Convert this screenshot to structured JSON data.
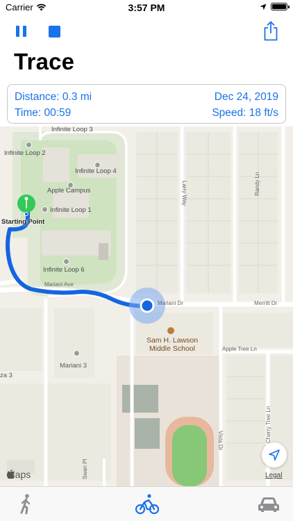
{
  "status_bar": {
    "carrier": "Carrier",
    "time": "3:57 PM"
  },
  "toolbar": {
    "pause_icon": "pause-icon",
    "stop_icon": "stop-icon",
    "share_icon": "share-icon",
    "accent_color": "#1a73e8"
  },
  "header": {
    "title": "Trace"
  },
  "stats": {
    "distance": "Distance: 0.3 mi",
    "date": "Dec 24, 2019",
    "time": "Time: 00:59",
    "speed": "Speed: 18 ft/s"
  },
  "map": {
    "places": {
      "infinite_loop_3": "Infinite Loop 3",
      "infinite_loop_2": "Infinite Loop 2",
      "infinite_loop_4": "Infinite Loop 4",
      "apple_campus": "Apple Campus",
      "infinite_loop_1": "Infinite Loop 1",
      "infinite_loop_6": "Infinite Loop 6",
      "mariani_3": "Mariani 3",
      "za_3": "za 3",
      "school_line1": "Sam H. Lawson",
      "school_line2": "Middle School"
    },
    "roads": {
      "larry_way": "Larry Way",
      "randy_ln": "Randy Ln",
      "mariani_ave": "Mariani Ave",
      "mariani_dr": "Mariani Dr",
      "merritt_dr": "Merritt Dr",
      "apple_tree_ln": "Apple Tree Ln",
      "cherry_tree_ln": "Cherry Tree Ln",
      "vista_dr": "Vista Dr",
      "swan_pl": "Swan Pl"
    },
    "start_label": "Starting Point",
    "maps_logo": "Maps",
    "legal": "Legal",
    "route_color": "#1565e0",
    "pin_color": "#34c759"
  },
  "tabs": {
    "walk_icon": "walk-icon",
    "bike_icon": "bike-icon",
    "car_icon": "car-icon",
    "selected": "bike"
  }
}
